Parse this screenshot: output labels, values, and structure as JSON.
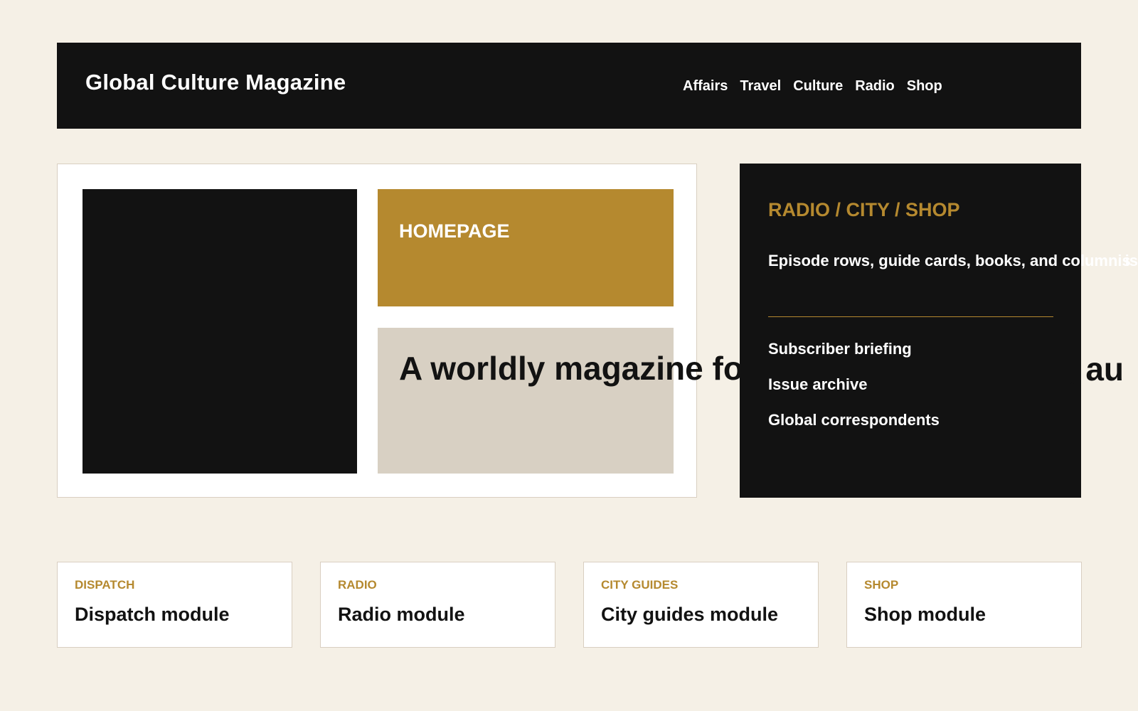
{
  "header": {
    "brand": "Global Culture Magazine",
    "nav": [
      "Affairs",
      "Travel",
      "Culture",
      "Radio",
      "Shop"
    ]
  },
  "hero": {
    "kicker": "HOMEPAGE",
    "headline": "A worldly magazine fo",
    "headline_overflow_visible": "l, au"
  },
  "sidebar": {
    "title": "RADIO / CITY / SHOP",
    "description": "Episode rows, guide cards, books, and columnis",
    "links": [
      "Subscriber briefing",
      "Issue archive",
      "Global correspondents"
    ]
  },
  "modules": [
    {
      "kicker": "DISPATCH",
      "title": "Dispatch module"
    },
    {
      "kicker": "RADIO",
      "title": "Radio module"
    },
    {
      "kicker": "CITY GUIDES",
      "title": "City guides module"
    },
    {
      "kicker": "SHOP",
      "title": "Shop module"
    }
  ],
  "colors": {
    "background": "#f5f0e6",
    "ink": "#121212",
    "accent": "#b5892f",
    "panel": "#d8d0c3"
  }
}
